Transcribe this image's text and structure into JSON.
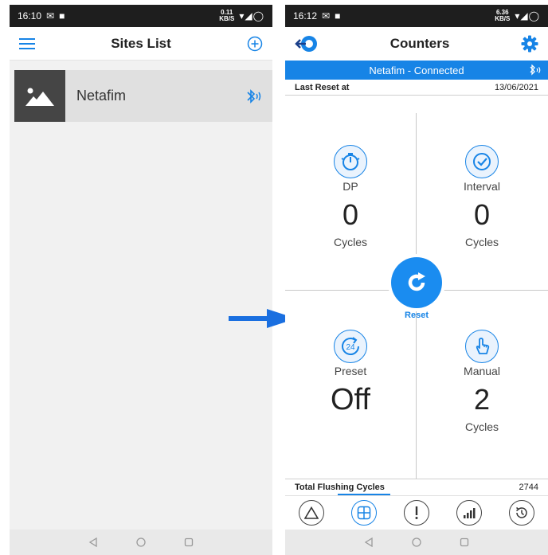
{
  "left_screen": {
    "status": {
      "time": "16:10",
      "net_speed": "0.11",
      "net_unit": "KB/S"
    },
    "title": "Sites List",
    "sites": [
      {
        "name": "Netafim"
      }
    ]
  },
  "right_screen": {
    "status": {
      "time": "16:12",
      "net_speed": "6.36",
      "net_unit": "KB/S"
    },
    "title": "Counters",
    "banner": "Netafim - Connected",
    "last_reset_label": "Last Reset at",
    "last_reset_date": "13/06/2021",
    "counters": {
      "dp": {
        "label": "DP",
        "value": "0",
        "unit": "Cycles"
      },
      "interval": {
        "label": "Interval",
        "value": "0",
        "unit": "Cycles"
      },
      "preset": {
        "label": "Preset",
        "value": "Off",
        "icon_text": "24"
      },
      "manual": {
        "label": "Manual",
        "value": "2",
        "unit": "Cycles"
      }
    },
    "reset_label": "Reset",
    "total_label": "Total Flushing Cycles",
    "total_value": "2744",
    "tabs": [
      "warning-triangle-icon",
      "dashboard-grid-icon",
      "alert-icon",
      "signal-chart-icon",
      "history-icon"
    ]
  },
  "colors": {
    "accent": "#1784e6",
    "status_bar": "#1e1e1e",
    "thumb_bg": "#454545"
  }
}
